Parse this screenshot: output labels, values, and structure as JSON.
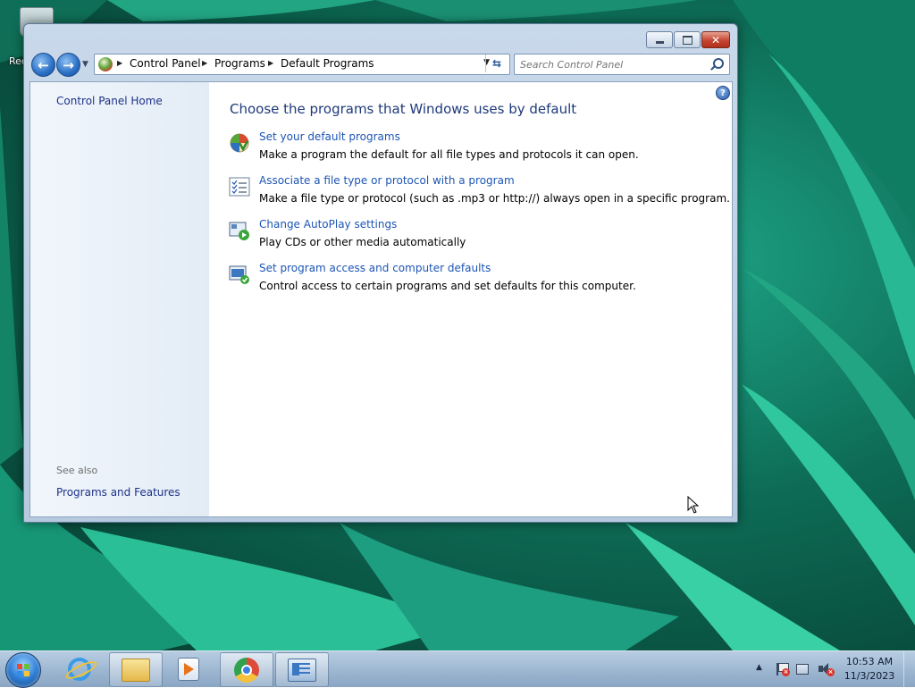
{
  "desktop": {
    "icons": [
      {
        "name": "recycle-bin-icon",
        "label": "Rec"
      }
    ]
  },
  "window": {
    "address_bar": {
      "crumbs": [
        "Control Panel",
        "Programs",
        "Default Programs"
      ]
    },
    "search": {
      "placeholder": "Search Control Panel"
    },
    "left_pane": {
      "home_link": "Control Panel Home",
      "see_also_label": "See also",
      "see_also_links": [
        "Programs and Features"
      ]
    },
    "main": {
      "title": "Choose the programs that Windows uses by default",
      "tasks": [
        {
          "icon": "default-programs-icon",
          "link": "Set your default programs",
          "description": "Make a program the default for all file types and protocols it can open."
        },
        {
          "icon": "file-association-icon",
          "link": "Associate a file type or protocol with a program",
          "description": "Make a file type or protocol (such as .mp3 or http://) always open in a specific program."
        },
        {
          "icon": "autoplay-icon",
          "link": "Change AutoPlay settings",
          "description": "Play CDs or other media automatically"
        },
        {
          "icon": "program-access-icon",
          "link": "Set program access and computer defaults",
          "description": "Control access to certain programs and set defaults for this computer."
        }
      ]
    },
    "help_glyph": "?"
  },
  "taskbar": {
    "apps": [
      "internet-explorer-icon",
      "windows-explorer-icon",
      "media-player-icon",
      "chrome-icon",
      "control-panel-icon"
    ],
    "clock": {
      "time": "10:53 AM",
      "date": "11/3/2023"
    }
  },
  "colors": {
    "link": "#1c55b5",
    "title": "#1e3a7a",
    "left_link": "#1e3287"
  }
}
